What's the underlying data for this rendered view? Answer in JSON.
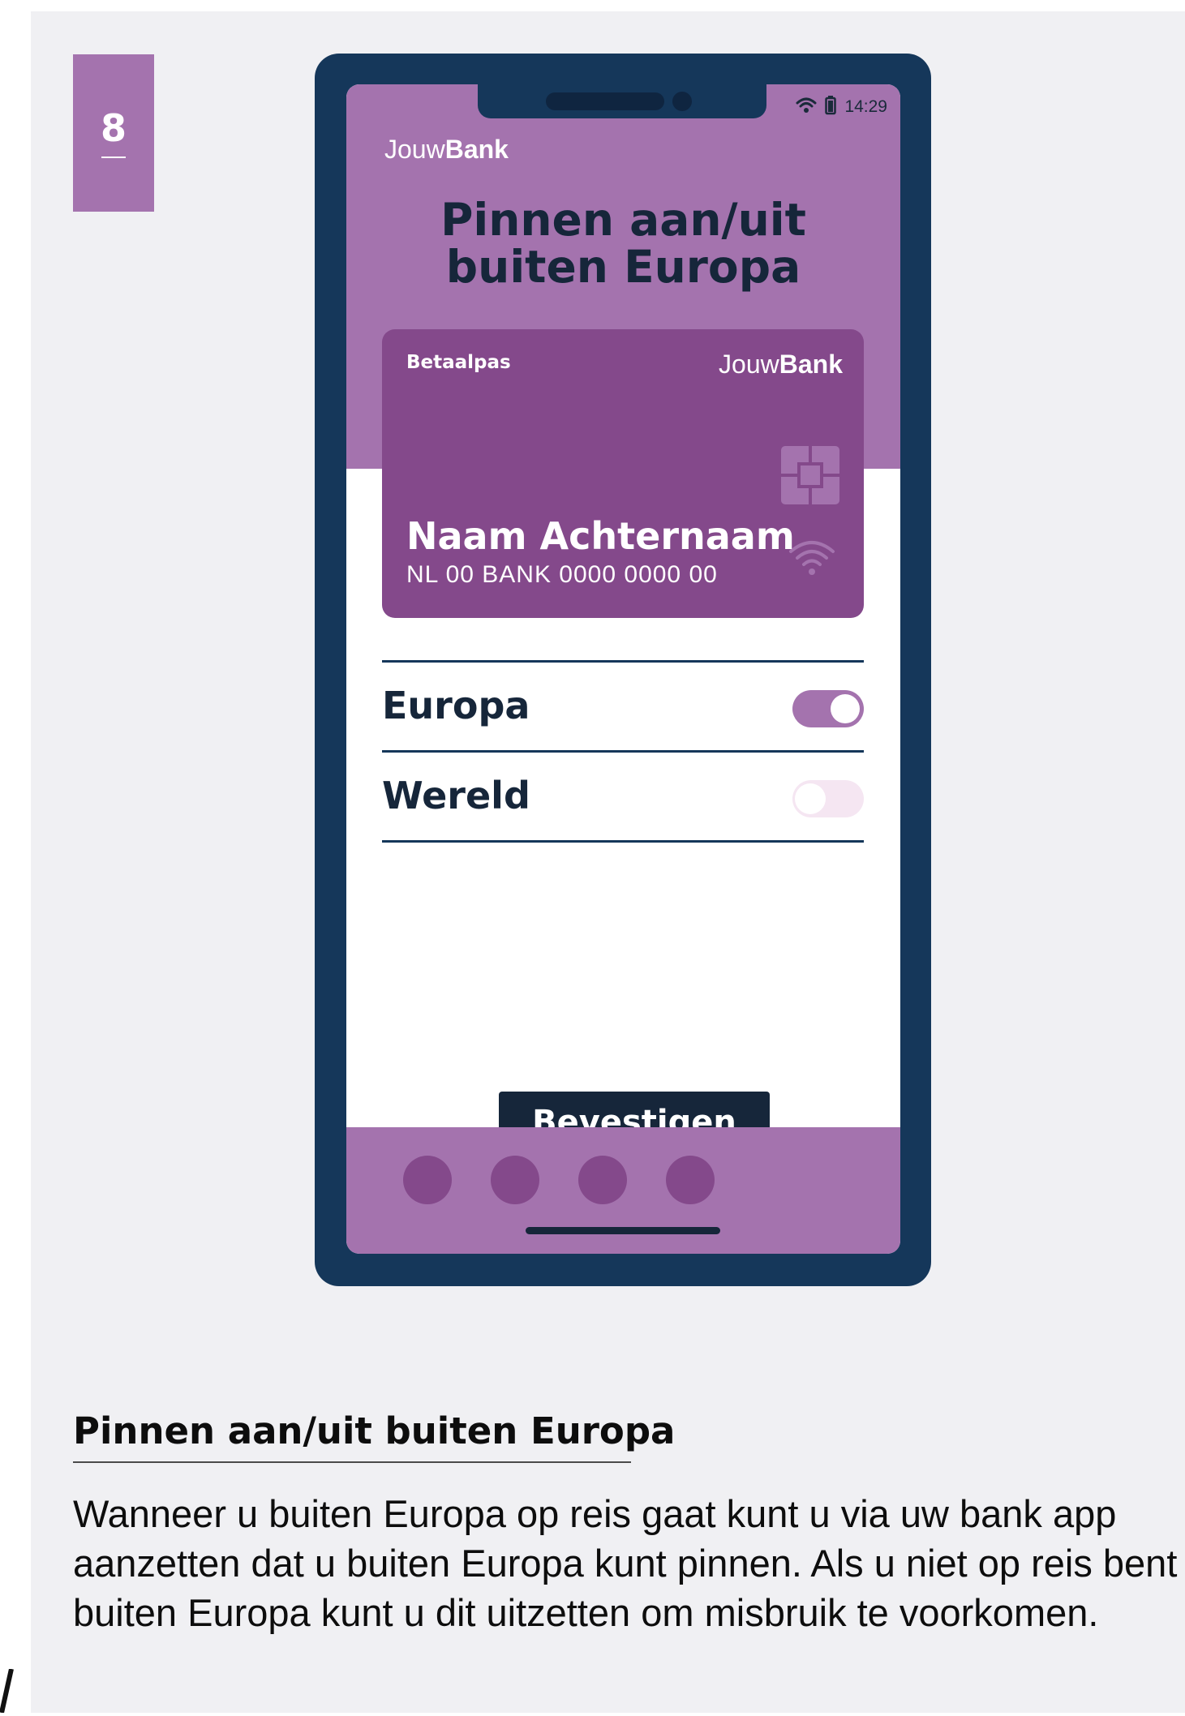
{
  "step": {
    "number": "8"
  },
  "phone": {
    "status_time": "14:29",
    "icons": [
      "wifi-icon",
      "battery-icon"
    ],
    "app_logo": {
      "regular": "Jouw",
      "bold": "Bank"
    },
    "title_line1": "Pinnen aan/uit",
    "title_line2": "buiten Europa",
    "card": {
      "label": "Betaalpas",
      "logo": {
        "regular": "Jouw",
        "bold": "Bank"
      },
      "name": "Naam Achternaam",
      "iban": "NL 00 BANK 0000 0000 00",
      "icons": [
        "chip-icon",
        "contactless-icon"
      ]
    },
    "toggles": [
      {
        "label": "Europa",
        "state": "on"
      },
      {
        "label": "Wereld",
        "state": "off"
      }
    ],
    "confirm_label": "Bevestigen",
    "nav_dots": 4
  },
  "description": {
    "heading": "Pinnen aan/uit buiten Europa",
    "text": "Wanneer u buiten Europa op reis gaat kunt u via uw bank app aanzetten dat u buiten Europa kunt pinnen. Als u niet op reis bent buiten Europa kunt u dit uitzetten om misbruik te voorkomen."
  },
  "colors": {
    "accent": "#a473ae",
    "card": "#84498b",
    "frame": "#15375a",
    "text_dark": "#16263a",
    "background": "#f0f0f3"
  }
}
